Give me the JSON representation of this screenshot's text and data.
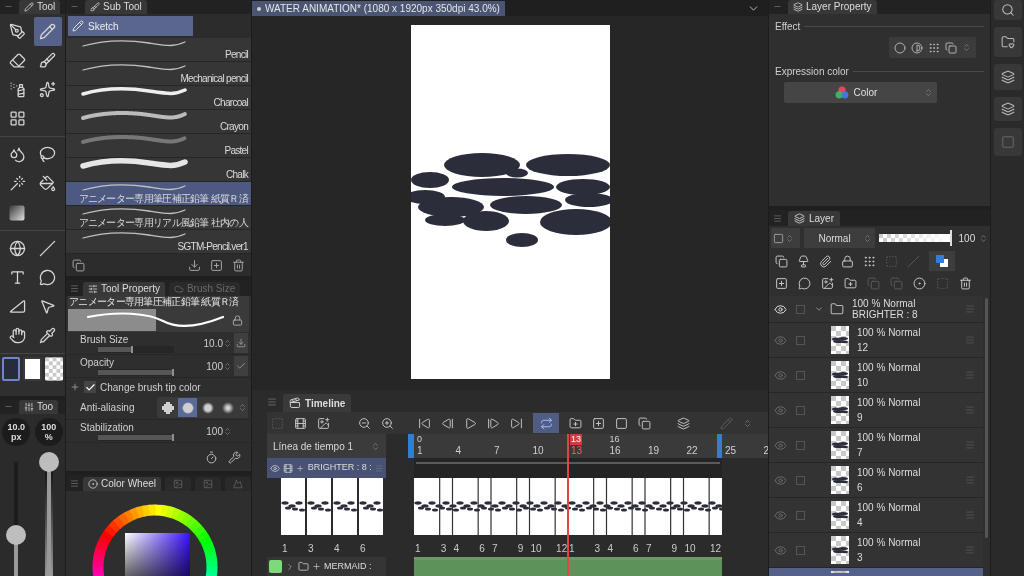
{
  "tool_palette": {
    "tab": "Tool",
    "groups": [
      {
        "tools": [
          {
            "kind": "pen",
            "selected": false
          },
          {
            "kind": "pencil",
            "selected": true
          },
          {
            "kind": "eraser",
            "selected": false
          },
          {
            "kind": "marker",
            "selected": false
          },
          {
            "kind": "airbrush",
            "selected": false
          },
          {
            "kind": "decoration",
            "selected": false
          },
          {
            "kind": "grid",
            "selected": false
          }
        ]
      },
      {
        "tools": [
          {
            "kind": "blend",
            "selected": false
          },
          {
            "kind": "lasso",
            "selected": false
          },
          {
            "kind": "wand",
            "selected": false
          },
          {
            "kind": "fill",
            "selected": false
          },
          {
            "kind": "gradient",
            "selected": false
          }
        ]
      },
      {
        "tools": [
          {
            "kind": "operation",
            "selected": false
          },
          {
            "kind": "line",
            "selected": false
          },
          {
            "kind": "text",
            "selected": false
          },
          {
            "kind": "balloon",
            "selected": false
          },
          {
            "kind": "ruler",
            "selected": false
          },
          {
            "kind": "move",
            "selected": false
          },
          {
            "kind": "hand",
            "selected": false
          },
          {
            "kind": "eyedropper",
            "selected": false
          }
        ]
      }
    ],
    "colors": [
      {
        "kind": "solid",
        "color": "#272b3b",
        "selected": true
      },
      {
        "kind": "solid",
        "color": "#ffffff",
        "selected": false
      },
      {
        "kind": "transparent",
        "selected": false
      }
    ]
  },
  "mini_tool": {
    "tab": "Too",
    "readouts": [
      {
        "kind": "size",
        "value": "10.0",
        "unit": "px",
        "level": 0.3
      },
      {
        "kind": "opacity",
        "value": "100",
        "unit": "%",
        "level": 1
      }
    ]
  },
  "sub_tool": {
    "tab": "Sub Tool",
    "group": "Sketch",
    "brushes": [
      {
        "name": "Pencil",
        "kind": "thin",
        "selected": false
      },
      {
        "name": "Mechanical pencil",
        "kind": "thin",
        "selected": false
      },
      {
        "name": "Charcoal",
        "kind": "thick",
        "selected": false
      },
      {
        "name": "Crayon",
        "kind": "grain",
        "selected": false
      },
      {
        "name": "Pastel",
        "kind": "soft",
        "selected": false
      },
      {
        "name": "Chalk",
        "kind": "heavy",
        "selected": false
      },
      {
        "name": "アニメーター専用筆圧補正鉛筆 紙質Ｒ済",
        "kind": "thin",
        "selected": true
      },
      {
        "name": "アニメーター専用リアル風鉛筆 社内の人",
        "kind": "thin",
        "selected": false
      },
      {
        "name": "SGTM-Pencil.ver1",
        "kind": "thin",
        "selected": false
      }
    ]
  },
  "tool_property": {
    "tabs": [
      {
        "label": "Tool Property",
        "selected": true
      },
      {
        "label": "Brush Size",
        "selected": false
      }
    ],
    "preset": "アニメーター専用筆圧補正鉛筆 紙質Ｒ済",
    "rows": [
      {
        "kind": "slider",
        "label": "Brush Size",
        "value": "10.0",
        "level": 0.45,
        "button": {
          "kind": "arrow"
        }
      },
      {
        "kind": "slider",
        "label": "Opacity",
        "value": "100",
        "level": 1,
        "button": {
          "kind": "check"
        }
      },
      {
        "kind": "checkbox",
        "label": "Change brush tip color",
        "checked": true
      },
      {
        "kind": "options",
        "label": "Anti-aliasing",
        "options": [
          {
            "selected": false
          },
          {
            "selected": true
          },
          {
            "selected": false
          },
          {
            "selected": false
          }
        ]
      },
      {
        "kind": "slider",
        "label": "Stabilization",
        "value": "100",
        "level": 1
      }
    ]
  },
  "color_panel": {
    "tab": "Color Wheel"
  },
  "canvas": {
    "title": "WATER ANIMATION* (1080 x 1920px 350dpi 43.0%)"
  },
  "timeline": {
    "tab": "Timeline",
    "loop": true,
    "name": "Línea de tiempo 1",
    "ticks": [
      {
        "label": "1",
        "marker": "0",
        "selected": false
      },
      {
        "label": "4",
        "selected": false
      },
      {
        "label": "7",
        "selected": false
      },
      {
        "label": "10",
        "selected": false
      },
      {
        "label": "13",
        "marker": "13",
        "selected": true
      },
      {
        "label": "16",
        "marker": "16",
        "selected": false
      },
      {
        "label": "19",
        "selected": false
      },
      {
        "label": "22",
        "selected": false
      },
      {
        "label": "25",
        "selected": false
      },
      {
        "label": "2",
        "selected": false
      }
    ],
    "tracks": [
      {
        "kind": "animation",
        "name": "BRIGHTER : 8 :",
        "selected": true,
        "previews": [
          "1",
          "3",
          "4",
          "6"
        ],
        "cels": [
          {
            "kind": "key",
            "label": "1"
          },
          {
            "kind": "hold"
          },
          {
            "kind": "key",
            "label": "3"
          },
          {
            "kind": "key",
            "label": "4"
          },
          {
            "kind": "hold"
          },
          {
            "kind": "key",
            "label": "6"
          },
          {
            "kind": "key",
            "label": "7"
          },
          {
            "kind": "hold"
          },
          {
            "kind": "key",
            "label": "9"
          },
          {
            "kind": "key",
            "label": "10"
          },
          {
            "kind": "hold"
          },
          {
            "kind": "key",
            "label": "12"
          },
          {
            "kind": "key",
            "label": "1"
          },
          {
            "kind": "hold"
          },
          {
            "kind": "key",
            "label": "3"
          },
          {
            "kind": "key",
            "label": "4"
          },
          {
            "kind": "hold"
          },
          {
            "kind": "key",
            "label": "6"
          },
          {
            "kind": "key",
            "label": "7"
          },
          {
            "kind": "hold"
          },
          {
            "kind": "key",
            "label": "9"
          },
          {
            "kind": "key",
            "label": "10"
          },
          {
            "kind": "hold"
          },
          {
            "kind": "key",
            "label": "12"
          }
        ]
      },
      {
        "kind": "folder",
        "name": "MERMAID :",
        "selected": false,
        "color": "#7fd97a"
      }
    ]
  },
  "layer_property": {
    "tab": "Layer Property",
    "effect": "Effect",
    "expression": "Expression color",
    "expression_value": "Color"
  },
  "layer_panel": {
    "tab": "Layer",
    "blend": "Normal",
    "opacity": "100",
    "level": 1,
    "layers": [
      {
        "kind": "folder",
        "info": "100 % Normal",
        "name": "BRIGHTER : 8",
        "visible": true,
        "expanded": true,
        "selected": false,
        "children": [
          {
            "kind": "raster",
            "info": "100 % Normal",
            "name": "12",
            "visible": true,
            "selected": false
          },
          {
            "kind": "raster",
            "info": "100 % Normal",
            "name": "10",
            "visible": true,
            "selected": false
          },
          {
            "kind": "raster",
            "info": "100 % Normal",
            "name": "9",
            "visible": true,
            "selected": false
          },
          {
            "kind": "raster",
            "info": "100 % Normal",
            "name": "7",
            "visible": true,
            "selected": false
          },
          {
            "kind": "raster",
            "info": "100 % Normal",
            "name": "6",
            "visible": true,
            "selected": false
          },
          {
            "kind": "raster",
            "info": "100 % Normal",
            "name": "4",
            "visible": true,
            "selected": false
          },
          {
            "kind": "raster",
            "info": "100 % Normal",
            "name": "3",
            "visible": true,
            "selected": false
          },
          {
            "kind": "raster",
            "selected": true
          }
        ]
      }
    ]
  }
}
